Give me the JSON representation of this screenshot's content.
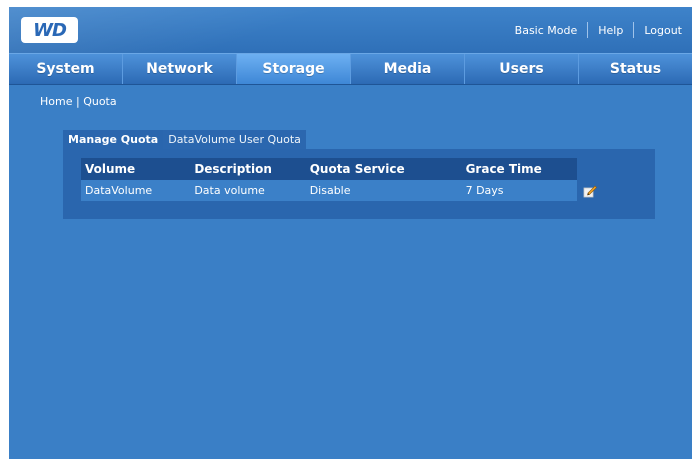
{
  "header": {
    "logo_text": "WD",
    "links": [
      "Basic Mode",
      "Help",
      "Logout"
    ]
  },
  "nav": {
    "tabs": [
      "System",
      "Network",
      "Storage",
      "Media",
      "Users",
      "Status"
    ],
    "active": "Storage"
  },
  "breadcrumb": {
    "home": "Home",
    "separator": " | ",
    "current": "Quota"
  },
  "subtabs": {
    "items": [
      "Manage Quota",
      "DataVolume User Quota"
    ],
    "active": "Manage Quota"
  },
  "table": {
    "headers": [
      "Volume",
      "Description",
      "Quota Service",
      "Grace Time"
    ],
    "rows": [
      [
        "DataVolume",
        "Data volume",
        "Disable",
        "7 Days"
      ]
    ]
  },
  "icons": {
    "edit": "edit-icon"
  },
  "colors": {
    "background": "#3a7fc6",
    "panel": "#2a66ae",
    "table_header": "#1d4f90",
    "table_row": "#3b80c8",
    "active_tab": "#6db0f2"
  }
}
